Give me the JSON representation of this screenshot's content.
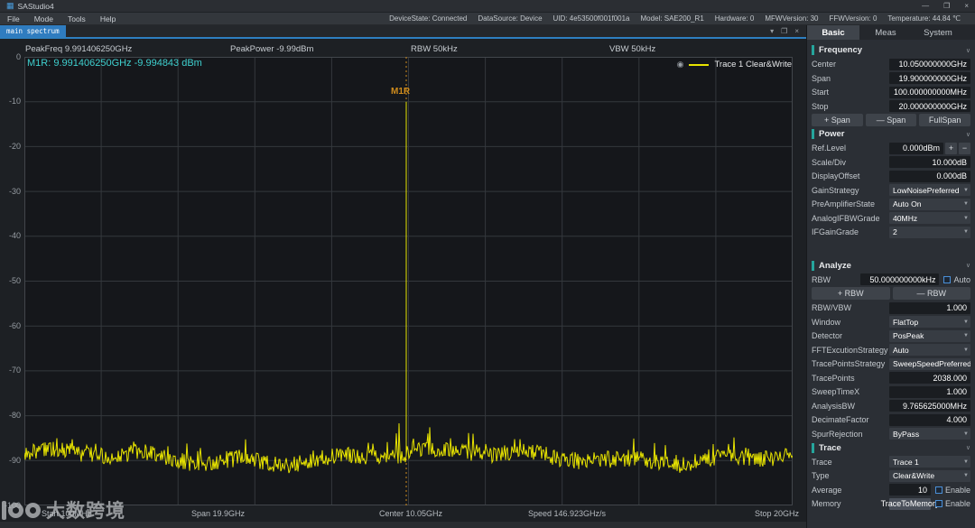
{
  "titlebar": {
    "title": "SAStudio4",
    "min_icon": "—",
    "max_icon": "❐",
    "close_icon": "×"
  },
  "menubar": {
    "items": [
      "File",
      "Mode",
      "Tools",
      "Help"
    ],
    "status": [
      "DeviceState: Connected",
      "DataSource: Device",
      "UID: 4e53500f001f001a",
      "Model: SAE200_R1",
      "Hardware: 0",
      "MFWVersion: 30",
      "FFWVersion: 0",
      "Temperature: 44.84 ℃"
    ]
  },
  "tabstrip": {
    "tab": "main spectrum",
    "collapse_icon": "▾",
    "float_icon": "❐",
    "close_icon": "×"
  },
  "plot": {
    "header": [
      "PeakFreq 9.991406250GHz",
      "PeakPower -9.99dBm",
      "RBW 50kHz",
      "VBW 50kHz"
    ],
    "marker_readout": "M1R: 9.991406250GHz  -9.994843 dBm",
    "legend_text": "Trace 1 Clear&Write",
    "footer": [
      "Start 100MHz",
      "Span 19.9GHz",
      "Center 10.05GHz",
      "Speed 146.923GHz/s",
      "Stop 20GHz"
    ]
  },
  "chart_data": {
    "type": "line",
    "title": "main spectrum",
    "x_axis": {
      "start": "100MHz",
      "stop": "20GHz",
      "center": "10.05GHz",
      "span": "19.9GHz",
      "start_ghz": 0.1,
      "stop_ghz": 20
    },
    "y_axis": {
      "unit": "dBm",
      "max": 0,
      "min": -100,
      "ticks": [
        0,
        -10,
        -20,
        -30,
        -40,
        -50,
        -60,
        -70,
        -80,
        -90,
        -100
      ]
    },
    "series": [
      {
        "name": "Trace 1",
        "mode": "Clear&Write",
        "color": "#e8e400",
        "noise_floor_dbm": -89.5,
        "peak": {
          "freq_ghz": 9.99140625,
          "power_dbm": -9.994843
        }
      }
    ],
    "marker": {
      "name": "M1R",
      "freq": "9.991406250GHz",
      "power": "-9.994843 dBm",
      "color": "#d08c1c"
    },
    "rbw": "50kHz",
    "vbw": "50kHz",
    "sweep_speed": "146.923GHz/s",
    "grid": true,
    "legend_position": "top-right"
  },
  "panel": {
    "tabs": [
      {
        "label": "Basic"
      },
      {
        "label": "Meas"
      },
      {
        "label": "System"
      }
    ],
    "frequency": {
      "title": "Frequency",
      "rows": [
        {
          "label": "Center",
          "value": "10.050000000GHz"
        },
        {
          "label": "Span",
          "value": "19.900000000GHz"
        },
        {
          "label": "Start",
          "value": "100.000000000MHz"
        },
        {
          "label": "Stop",
          "value": "20.000000000GHz"
        }
      ],
      "buttons": [
        "+ Span",
        "— Span",
        "FullSpan"
      ]
    },
    "power": {
      "title": "Power",
      "ref_level": {
        "label": "Ref.Level",
        "value": "0.000dBm",
        "inc": "+",
        "dec": "−"
      },
      "rows": [
        {
          "label": "Scale/Div",
          "value": "10.000dB"
        },
        {
          "label": "DisplayOffset",
          "value": "0.000dB"
        }
      ],
      "selects": [
        {
          "label": "GainStrategy",
          "value": "LowNoisePreferred"
        },
        {
          "label": "PreAmplifierState",
          "value": "Auto On"
        },
        {
          "label": "AnalogIFBWGrade",
          "value": "40MHz"
        },
        {
          "label": "IFGainGrade",
          "value": "2"
        }
      ]
    },
    "analyze": {
      "title": "Analyze",
      "rbw": {
        "label": "RBW",
        "value": "50.000000000kHz",
        "auto_label": "Auto"
      },
      "buttons": [
        "+ RBW",
        "— RBW"
      ],
      "ratio": {
        "label": "RBW/VBW",
        "value": "1.000"
      },
      "selects1": [
        {
          "label": "Window",
          "value": "FlatTop"
        },
        {
          "label": "Detector",
          "value": "PosPeak"
        },
        {
          "label": "FFTExcutionStrategy",
          "value": "Auto"
        },
        {
          "label": "TracePointsStrategy",
          "value": "SweepSpeedPreferred"
        }
      ],
      "rows2": [
        {
          "label": "TracePoints",
          "value": "2038.000"
        },
        {
          "label": "SweepTimeX",
          "value": "1.000"
        },
        {
          "label": "AnalysisBW",
          "value": "9.765625000MHz"
        },
        {
          "label": "DecimateFactor",
          "value": "4.000"
        }
      ],
      "selects2": [
        {
          "label": "SpurRejection",
          "value": "ByPass"
        }
      ]
    },
    "trace": {
      "title": "Trace",
      "selects": [
        {
          "label": "Trace",
          "value": "Trace 1"
        },
        {
          "label": "Type",
          "value": "Clear&Write"
        }
      ],
      "average": {
        "label": "Average",
        "value": "10",
        "enable": "Enable"
      },
      "memory": {
        "label": "Memory",
        "button": "TraceToMemory",
        "enable": "Enable"
      }
    }
  },
  "watermark": {
    "text": "大数跨境"
  },
  "colors": {
    "accent_blue": "#2e7fc0",
    "tab_blue": "#2f7cc0",
    "trace_yellow": "#e8e400",
    "marker_orange": "#d08c1c",
    "readout_cyan": "#3fd0cf",
    "section_teal": "#25a59c"
  }
}
